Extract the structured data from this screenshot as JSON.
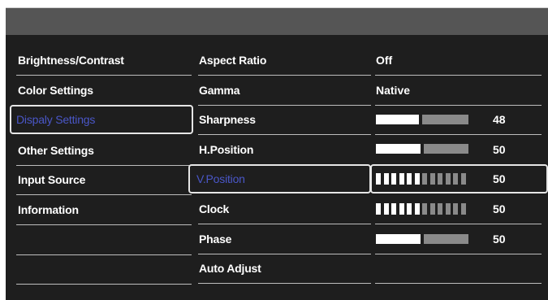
{
  "menu": {
    "items": [
      {
        "label": "Brightness/Contrast"
      },
      {
        "label": "Color Settings"
      },
      {
        "label": "Dispaly Settings",
        "selected": true
      },
      {
        "label": "Other Settings"
      },
      {
        "label": "Input Source"
      },
      {
        "label": "Information"
      }
    ]
  },
  "submenu": {
    "items": [
      {
        "label": "Aspect Ratio"
      },
      {
        "label": "Gamma"
      },
      {
        "label": "Sharpness"
      },
      {
        "label": "H.Position"
      },
      {
        "label": "V.Position",
        "selected": true
      },
      {
        "label": "Clock"
      },
      {
        "label": "Phase"
      },
      {
        "label": "Auto Adjust"
      }
    ]
  },
  "values": {
    "aspect_ratio": "Off",
    "gamma": "Native",
    "sharpness": "48",
    "h_position": "50",
    "v_position": "50",
    "clock": "50",
    "phase": "50"
  },
  "levels": {
    "sharpness": 0.48,
    "h_position": 0.5,
    "v_position": 0.5,
    "clock": 0.5,
    "phase": 0.5
  },
  "colors": {
    "osd_background": "#1e1e1e",
    "title_bar": "#555555",
    "selected_text": "#4a57c8",
    "bar_fill": "#ffffff",
    "bar_empty": "#8a8a8a"
  }
}
